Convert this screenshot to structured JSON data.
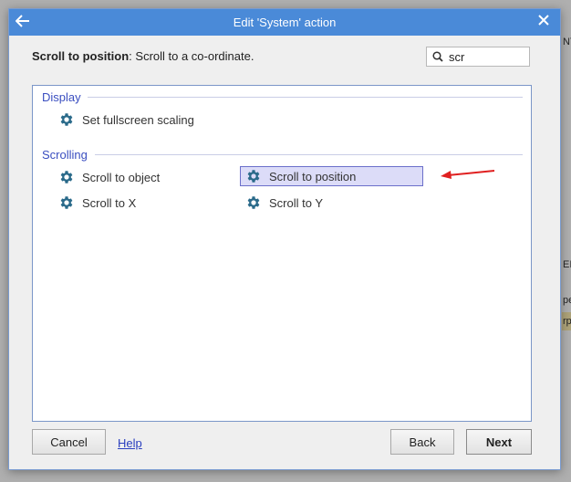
{
  "background": {
    "fragments": [
      "NT",
      "EI",
      "pe",
      "rp"
    ]
  },
  "dialog": {
    "title": "Edit 'System' action",
    "back_icon": "arrow-left-icon",
    "close_icon": "close-icon",
    "description_bold": "Scroll to position",
    "description_rest": ": Scroll to a co-ordinate.",
    "search": {
      "value": "scr",
      "placeholder": ""
    },
    "groups": [
      {
        "label": "Display",
        "items": [
          {
            "label": "Set fullscreen scaling",
            "icon": "gear-icon",
            "selected": false
          }
        ]
      },
      {
        "label": "Scrolling",
        "items": [
          {
            "label": "Scroll to object",
            "icon": "gear-icon",
            "selected": false
          },
          {
            "label": "Scroll to position",
            "icon": "gear-icon",
            "selected": true
          },
          {
            "label": "Scroll to X",
            "icon": "gear-icon",
            "selected": false
          },
          {
            "label": "Scroll to Y",
            "icon": "gear-icon",
            "selected": false
          }
        ]
      }
    ],
    "buttons": {
      "cancel": "Cancel",
      "help": "Help",
      "back": "Back",
      "next": "Next"
    }
  },
  "colors": {
    "titlebar": "#4a8ad8",
    "group_header": "#3a4ec0",
    "selection_bg": "#dcdcf8",
    "selection_border": "#6b6fca",
    "gear": "#2a6a8a",
    "annotation_arrow": "#e02020"
  }
}
